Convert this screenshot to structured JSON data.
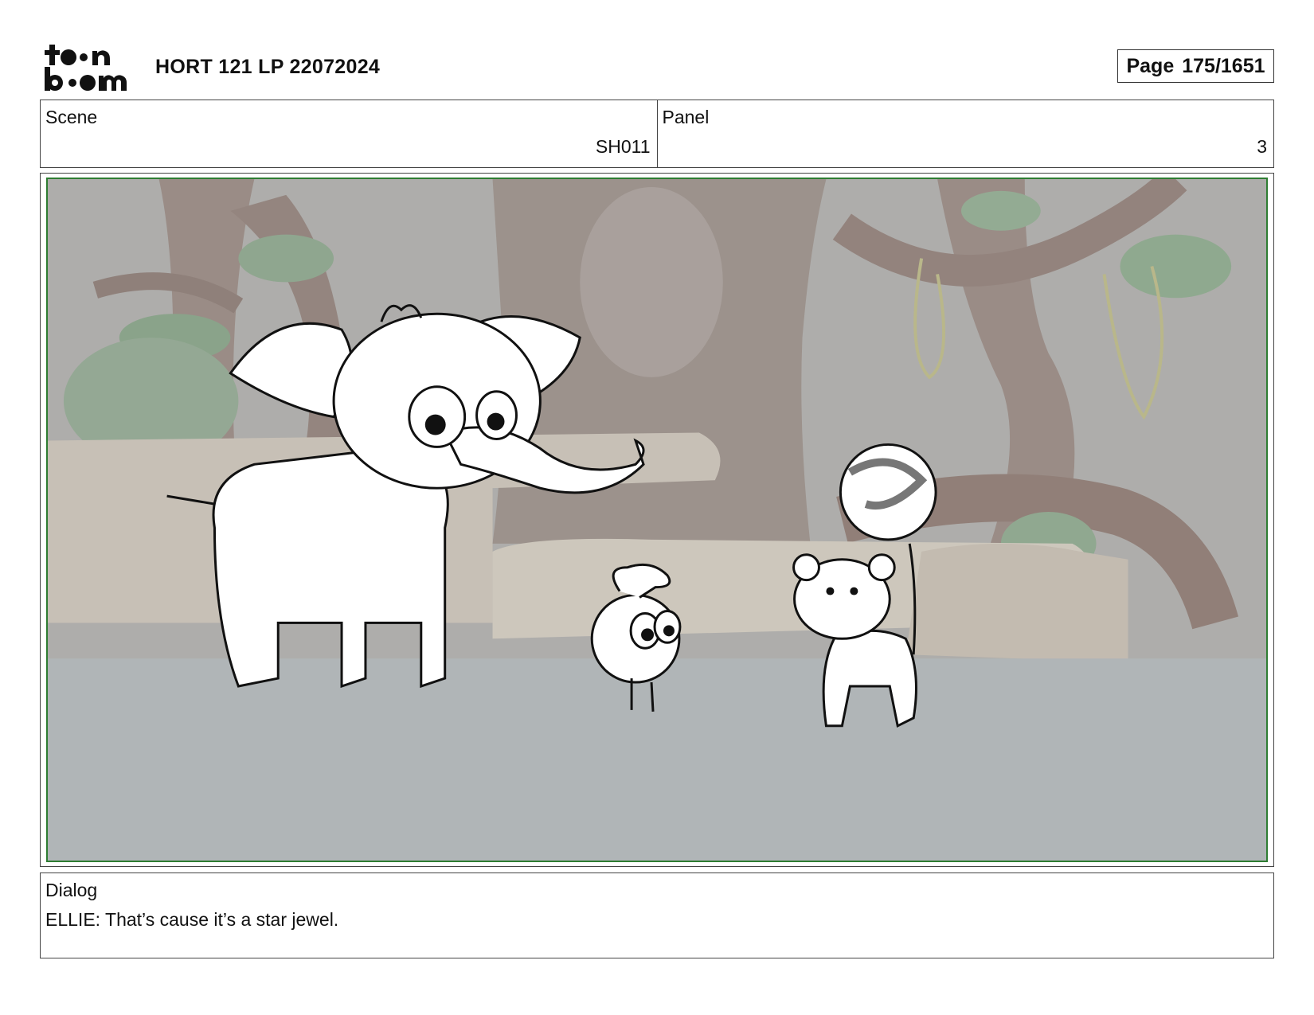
{
  "header": {
    "logo_top": "t  n",
    "logo_bottom": "b  m",
    "document_title": "HORT 121 LP 22072024",
    "page_label": "Page",
    "page_number": "175/1651"
  },
  "info": {
    "scene_label": "Scene",
    "scene_value": "SH011",
    "panel_label": "Panel",
    "panel_value": "3"
  },
  "dialog": {
    "label": "Dialog",
    "text": "ELLIE: That’s cause it’s a star jewel."
  },
  "colors": {
    "frame_green": "#2e7d32",
    "border": "#444444",
    "background_fill": "#b0b0ae"
  }
}
